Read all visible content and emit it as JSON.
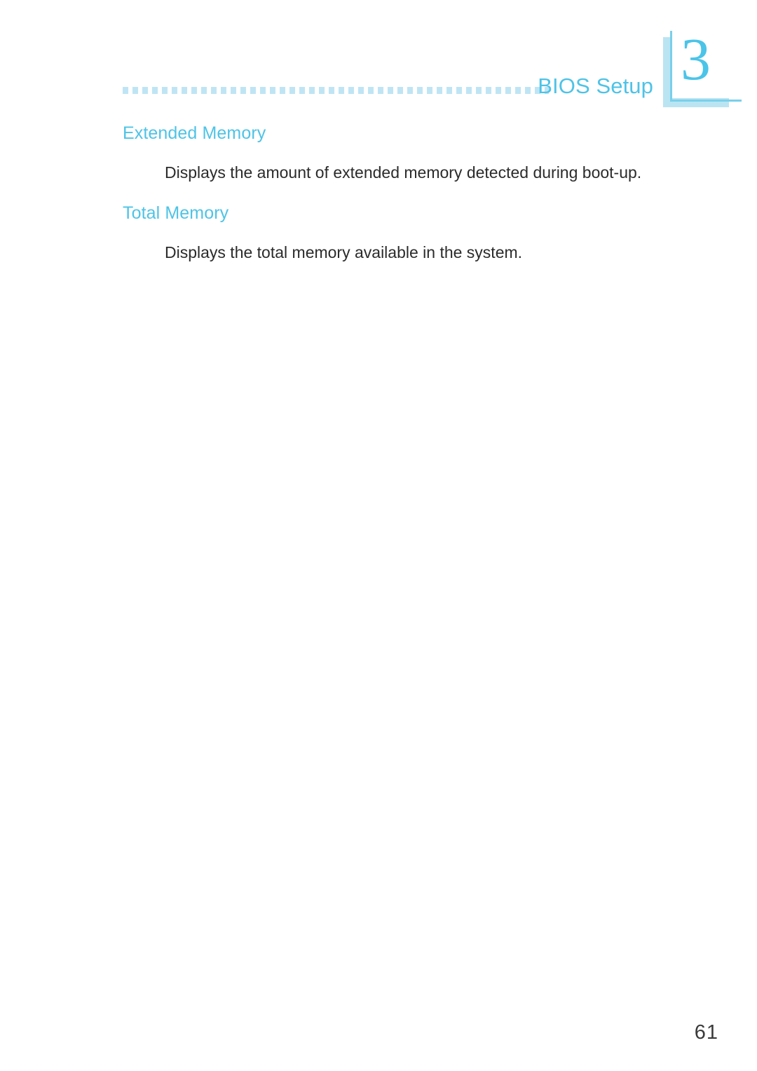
{
  "header": {
    "title": "BIOS Setup",
    "chapter_number": "3",
    "rule_style": "dotted-squares",
    "accent_color": "#4ec3e6",
    "rule_color": "#bfe5f4",
    "bracket_color": "#bae4f2",
    "bracket_line_color": "#79d0ea"
  },
  "content": {
    "sections": [
      {
        "heading": "Extended Memory",
        "text": "Displays the amount of extended memory detected during boot-up."
      },
      {
        "heading": "Total Memory",
        "text": "Displays the total memory available in the system."
      }
    ]
  },
  "footer": {
    "page_number": "61"
  }
}
